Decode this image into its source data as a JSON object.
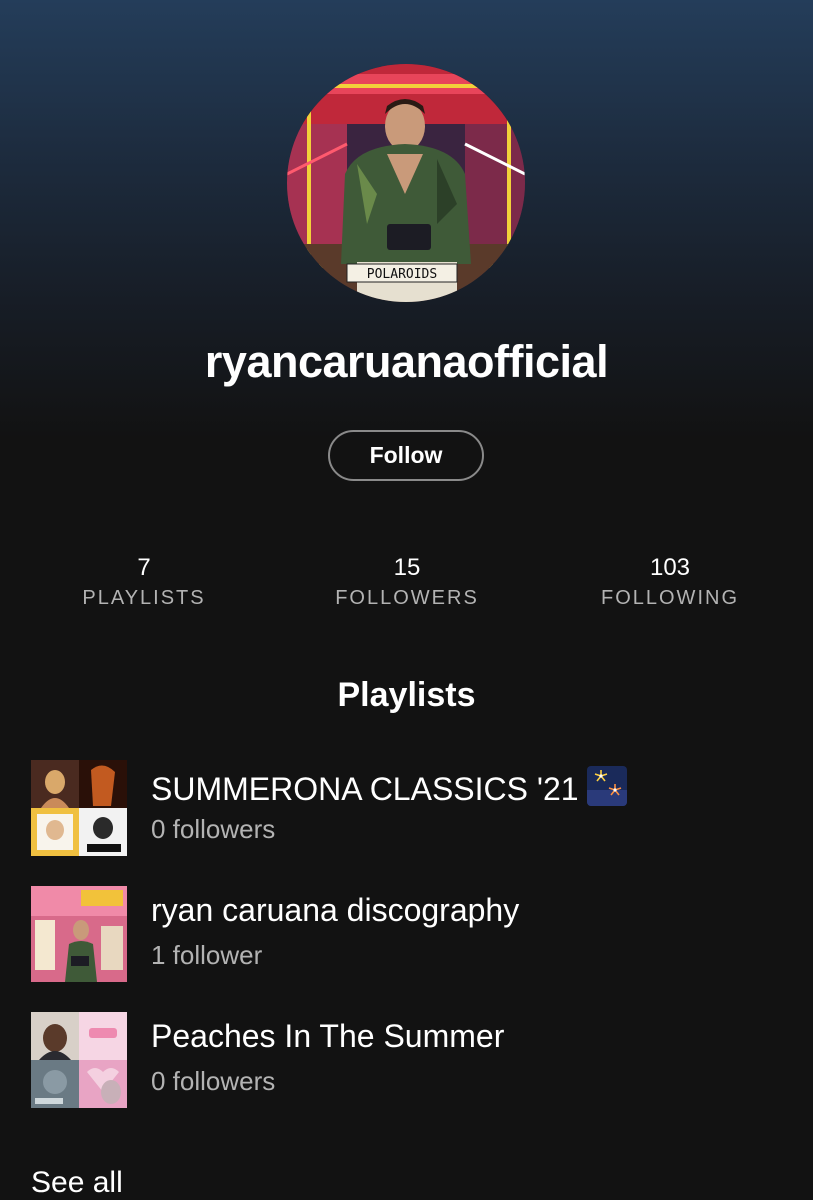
{
  "profile": {
    "username": "ryancaruanaofficial",
    "follow_label": "Follow",
    "avatar_icon": "profile-avatar-image",
    "avatar_caption": "POLAROIDS"
  },
  "stats": [
    {
      "value": "7",
      "label": "PLAYLISTS"
    },
    {
      "value": "15",
      "label": "FOLLOWERS"
    },
    {
      "value": "103",
      "label": "FOLLOWING"
    }
  ],
  "playlists_section": {
    "title": "Playlists",
    "items": [
      {
        "title": "SUMMERONA CLASSICS '21",
        "emoji": "fireworks-emoji",
        "subtitle": "0 followers"
      },
      {
        "title": "ryan caruana discography",
        "subtitle": "1 follower"
      },
      {
        "title": "Peaches In The Summer",
        "subtitle": "0 followers"
      }
    ],
    "see_all_label": "See all"
  },
  "colors": {
    "background": "#121212",
    "header_gradient_top": "#243d5a",
    "secondary_text": "#b3b3b3",
    "button_border": "#8a8a8a"
  }
}
